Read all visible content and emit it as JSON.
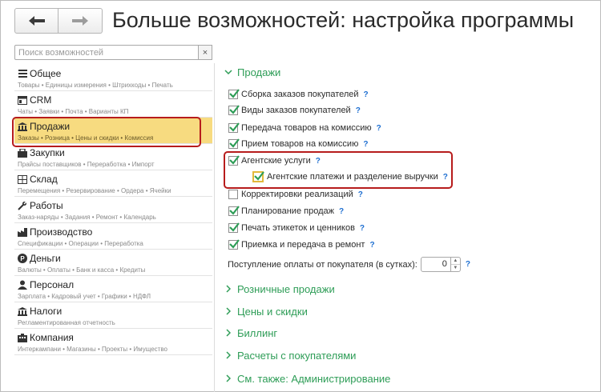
{
  "header": {
    "title": "Больше возможностей: настройка программы",
    "back_icon": "arrow-left-icon",
    "forward_icon": "arrow-right-icon"
  },
  "search": {
    "placeholder": "Поиск возможностей",
    "clear_label": "×"
  },
  "sidebar": {
    "items": [
      {
        "label": "Общее",
        "sub": "Товары • Единицы измерения • Штрихкоды • Печать",
        "icon": "list-icon",
        "active": false
      },
      {
        "label": "CRM",
        "sub": "Чаты • Заявки • Почта • Варианты КП",
        "icon": "crm-icon",
        "active": false
      },
      {
        "label": "Продажи",
        "sub": "Заказы • Розница • Цены и скидки • Комиссия",
        "icon": "sales-icon",
        "active": true
      },
      {
        "label": "Закупки",
        "sub": "Прайсы поставщиков • Переработка • Импорт",
        "icon": "purchases-icon",
        "active": false
      },
      {
        "label": "Склад",
        "sub": "Перемещения • Резервирование • Ордера • Ячейки",
        "icon": "warehouse-icon",
        "active": false
      },
      {
        "label": "Работы",
        "sub": "Заказ-наряды • Задания • Ремонт • Календарь",
        "icon": "tools-icon",
        "active": false
      },
      {
        "label": "Производство",
        "sub": "Спецификации • Операции • Переработка",
        "icon": "production-icon",
        "active": false
      },
      {
        "label": "Деньги",
        "sub": "Валюты • Оплаты • Банк и касса • Кредиты",
        "icon": "money-icon",
        "active": false
      },
      {
        "label": "Персонал",
        "sub": "Зарплата • Кадровый учет • Графики • НДФЛ",
        "icon": "staff-icon",
        "active": false
      },
      {
        "label": "Налоги",
        "sub": "Регламентированная отчетность",
        "icon": "taxes-icon",
        "active": false
      },
      {
        "label": "Компания",
        "sub": "Интеркампани • Магазины • Проекты • Имущество",
        "icon": "company-icon",
        "active": false
      }
    ]
  },
  "main": {
    "group_title": "Продажи",
    "options": [
      {
        "label": "Сборка заказов покупателей",
        "checked": true
      },
      {
        "label": "Виды заказов покупателей",
        "checked": true
      },
      {
        "label": "Передача товаров на комиссию",
        "checked": true
      },
      {
        "label": "Прием товаров на комиссию",
        "checked": true
      },
      {
        "label": "Агентские услуги",
        "checked": true
      },
      {
        "label": "Агентские платежи и разделение выручки",
        "checked": true
      },
      {
        "label": "Корректировки реализаций",
        "checked": false
      },
      {
        "label": "Планирование продаж",
        "checked": true
      },
      {
        "label": "Печать этикеток и ценников",
        "checked": true
      },
      {
        "label": "Приемка и передача в ремонт",
        "checked": true
      }
    ],
    "help_mark": "?",
    "payment_label": "Поступление оплаты от покупателя (в сутках):",
    "payment_value": "0",
    "collapsed_groups": [
      "Розничные продажи",
      "Цены и скидки",
      "Биллинг",
      "Расчеты с покупателями",
      "См. также: Администрирование"
    ]
  },
  "colors": {
    "accent_green": "#2e9d57",
    "highlight_yellow": "#f7db80",
    "annotation_red": "#b71c1c",
    "help_blue": "#1e6fd1"
  }
}
